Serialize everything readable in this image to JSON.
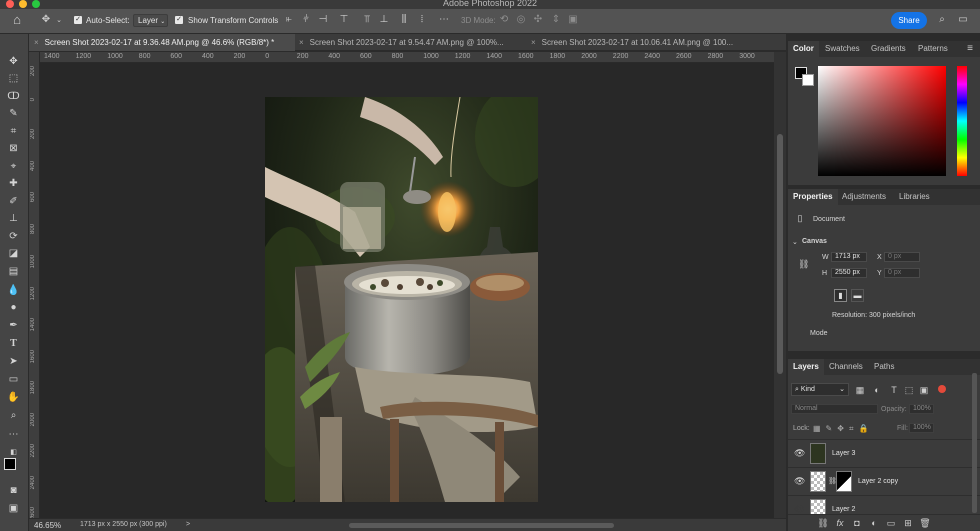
{
  "app": {
    "title": "Adobe Photoshop 2022",
    "traffic_lights": [
      "#fe5f57",
      "#febc2e",
      "#28c840"
    ]
  },
  "options_bar": {
    "home_icon": "home-icon",
    "move_icon": "move-tool-icon",
    "auto_select_label": "Auto-Select:",
    "auto_select_checked": true,
    "auto_select_target": "Layer",
    "show_transform_label": "Show Transform Controls",
    "show_transform_checked": true,
    "mode_3d_label": "3D Mode:",
    "share_label": "Share",
    "share_color": "#1473e6"
  },
  "tabs": [
    {
      "label": "Screen Shot 2023-02-17 at 9.36.48 AM.png @ 46.6% (RGB/8*) *",
      "close": "×",
      "active": true
    },
    {
      "label": "Screen Shot 2023-02-17 at 9.54.47 AM.png @ 100%...",
      "close": "×",
      "active": false
    },
    {
      "label": "Screen Shot 2023-02-17 at 10.06.41 AM.png @ 100...",
      "close": "×",
      "active": false
    }
  ],
  "ruler": {
    "horizontal": [
      "1400",
      "1200",
      "1000",
      "800",
      "600",
      "400",
      "200",
      "0",
      "200",
      "400",
      "600",
      "800",
      "1000",
      "1200",
      "1400",
      "1600",
      "1800",
      "2000",
      "2200",
      "2400",
      "2600",
      "2800",
      "3000"
    ],
    "vertical": [
      "200",
      "0",
      "200",
      "400",
      "600",
      "800",
      "1000",
      "1200",
      "1400",
      "1600",
      "1800",
      "2000",
      "2200",
      "2400",
      "2600"
    ]
  },
  "status": {
    "zoom": "46.65%",
    "doc_info": "1713 px x 2550 px (300 ppi)",
    "arrow": ">"
  },
  "color_panel": {
    "tabs": [
      "Color",
      "Swatches",
      "Gradients",
      "Patterns"
    ],
    "hue_color": "#ff0000"
  },
  "properties_panel": {
    "tabs": [
      "Properties",
      "Adjustments",
      "Libraries"
    ],
    "document_label": "Document",
    "canvas_label": "Canvas",
    "w_label": "W",
    "w_value": "1713 px",
    "h_label": "H",
    "h_value": "2550 px",
    "x_label": "X",
    "x_value": "0 px",
    "y_label": "Y",
    "y_value": "0 px",
    "resolution": "Resolution: 300 pixels/inch",
    "mode_label": "Mode"
  },
  "layers_panel": {
    "tabs": [
      "Layers",
      "Channels",
      "Paths"
    ],
    "kind_label": "Kind",
    "blend_mode": "Normal",
    "opacity_label": "Opacity:",
    "opacity_value": "100%",
    "lock_label": "Lock:",
    "fill_label": "Fill:",
    "fill_value": "100%",
    "layers": [
      {
        "name": "Layer 3",
        "visible": true
      },
      {
        "name": "Layer 2 copy",
        "visible": true
      },
      {
        "name": "Layer 2",
        "visible": false
      }
    ]
  }
}
